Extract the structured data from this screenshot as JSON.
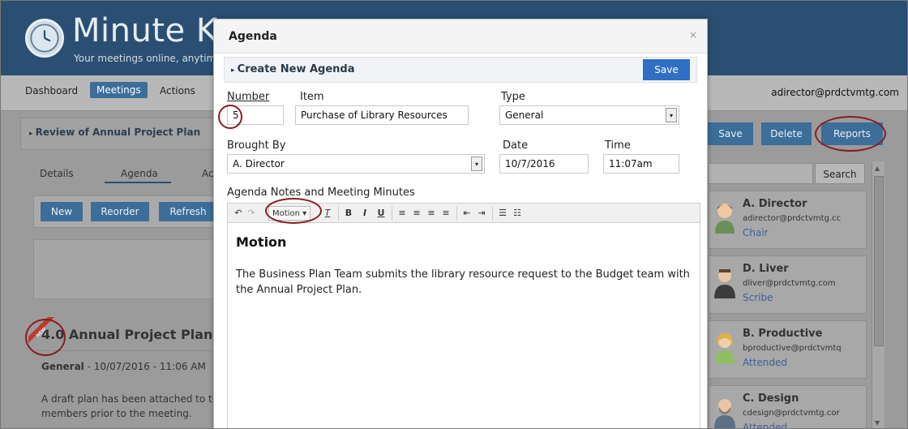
{
  "app": {
    "brand": "Minute Ke",
    "tagline": "Your meetings online, anytime",
    "user_email": "adirector@prdctvmtg.com"
  },
  "nav": {
    "items": [
      "Dashboard",
      "Meetings",
      "Actions"
    ],
    "active": "Meetings"
  },
  "meeting": {
    "title": "Review of Annual Project Plan",
    "tabs": [
      "Details",
      "Agenda",
      "Ac"
    ],
    "active_tab": "Agenda",
    "buttons": [
      "New",
      "Reorder",
      "Refresh"
    ],
    "item": {
      "badge": "NEW",
      "number": "4.0",
      "title": "Annual Project Plan",
      "type": "General",
      "datetime": " - 10/07/2016 - 11:06 AM",
      "description": "A draft plan has been attached to thi members prior to the meeting."
    }
  },
  "right": {
    "actions": [
      "Save",
      "Delete",
      "Reports"
    ],
    "search_label": "Search",
    "attendees": [
      {
        "name": "A. Director",
        "email": "adirector@prdctvmtg.cc",
        "role": "Chair"
      },
      {
        "name": "D. Liver",
        "email": "dliver@prdctvmtg.com",
        "role": "Scribe"
      },
      {
        "name": "B. Productive",
        "email": "bproductive@prdctvmtq",
        "role": "Attended"
      },
      {
        "name": "C. Design",
        "email": "cdesign@prdctvmtg.cor",
        "role": "Attended"
      }
    ]
  },
  "modal": {
    "title": "Agenda",
    "close": "×",
    "section_title": "Create New Agenda",
    "save_label": "Save",
    "fields": {
      "number_label": "Number",
      "number_value": "5",
      "item_label": "Item",
      "item_value": "Purchase of Library Resources",
      "type_label": "Type",
      "type_value": "General",
      "brought_by_label": "Brought By",
      "brought_by_value": "A. Director",
      "date_label": "Date",
      "date_value": "10/7/2016",
      "time_label": "Time",
      "time_value": "11:07am"
    },
    "editor": {
      "label": "Agenda Notes and Meeting Minutes",
      "format_dropdown": "Motion",
      "heading": "Motion",
      "body": "The Business Plan Team submits the library resource request to the Budget team with the Annual Project Plan."
    }
  },
  "colors": {
    "header_bg": "#2a4f73",
    "primary_button": "#2f6fc4",
    "annotation_circle": "#8a1c24",
    "overlay": "#9b9b9b"
  }
}
